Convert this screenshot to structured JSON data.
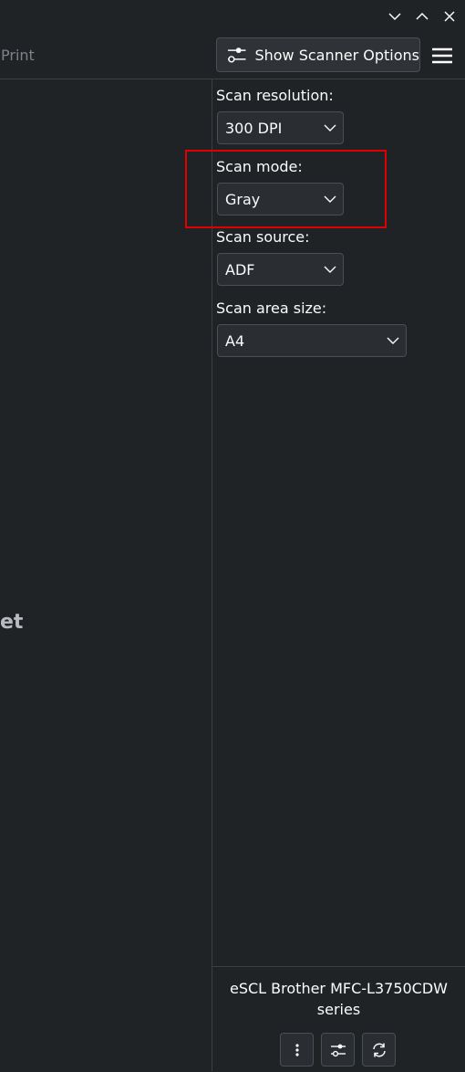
{
  "toolbar": {
    "print_label": "Print",
    "show_options_label": "Show Scanner Options"
  },
  "left_pane": {
    "partial_text": "et"
  },
  "options": {
    "resolution": {
      "label": "Scan resolution:",
      "value": "300 DPI"
    },
    "mode": {
      "label": "Scan mode:",
      "value": "Gray"
    },
    "source": {
      "label": "Scan source:",
      "value": "ADF"
    },
    "area": {
      "label": "Scan area size:",
      "value": "A4"
    }
  },
  "footer": {
    "device_name": "eSCL Brother MFC-L3750CDW series"
  },
  "icons": {
    "minimize": "chevron-down-icon",
    "maximize": "chevron-up-icon",
    "close": "close-icon",
    "scanner_options": "sliders-icon",
    "menu": "hamburger-menu-icon",
    "more": "kebab-menu-icon",
    "settings": "sliders-icon",
    "refresh": "refresh-icon"
  },
  "colors": {
    "background": "#202326",
    "highlight": "#e00000",
    "text": "#fcfcfc"
  }
}
